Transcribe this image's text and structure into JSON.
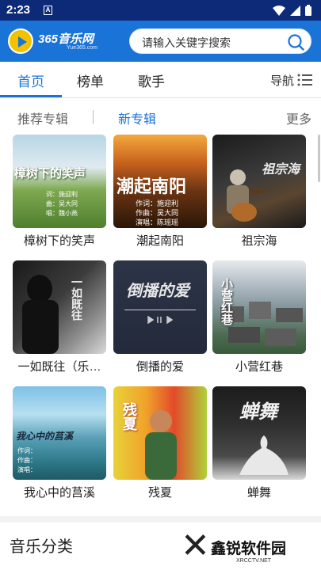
{
  "status_bar": {
    "time": "2:23",
    "notif": "A"
  },
  "header": {
    "logo_text": "365音乐网",
    "logo_sub": "Yue365.com",
    "search_placeholder": "请输入关键字搜索"
  },
  "tabs": [
    {
      "label": "首页",
      "active": true
    },
    {
      "label": "榜单",
      "active": false
    },
    {
      "label": "歌手",
      "active": false
    }
  ],
  "nav_label": "导航",
  "subtabs": {
    "recommended": "推荐专辑",
    "new": "新专辑",
    "more": "更多"
  },
  "albums": [
    {
      "title": "樟树下的笑声",
      "cover_text": "樟树下的笑声",
      "cover_lines": [
        "词：施迎利",
        "曲：吴大同",
        "唱：魏小燕"
      ]
    },
    {
      "title": "潮起南阳",
      "cover_text": "潮起南阳",
      "cover_lines": [
        "作词：施迎利",
        "作曲：吴大同",
        "演唱：陈瑶瑶"
      ]
    },
    {
      "title": "祖宗海",
      "cover_text": "祖宗海"
    },
    {
      "title": "一如既往（乐…",
      "cover_text": "一如既往"
    },
    {
      "title": "倒播的爱",
      "cover_text": "倒播的爱"
    },
    {
      "title": "小营红巷",
      "cover_text": "小营红巷"
    },
    {
      "title": "我心中的莒溪",
      "cover_text": "我心中的莒溪",
      "cover_lines": [
        "作词：",
        "作曲：",
        "演唱："
      ]
    },
    {
      "title": "残夏",
      "cover_text": "残夏"
    },
    {
      "title": "蝉舞",
      "cover_text": "蝉舞"
    }
  ],
  "section": {
    "title": "音乐分类"
  },
  "watermark": {
    "text": "鑫锐软件园",
    "url": "XRCCTV.NET"
  }
}
